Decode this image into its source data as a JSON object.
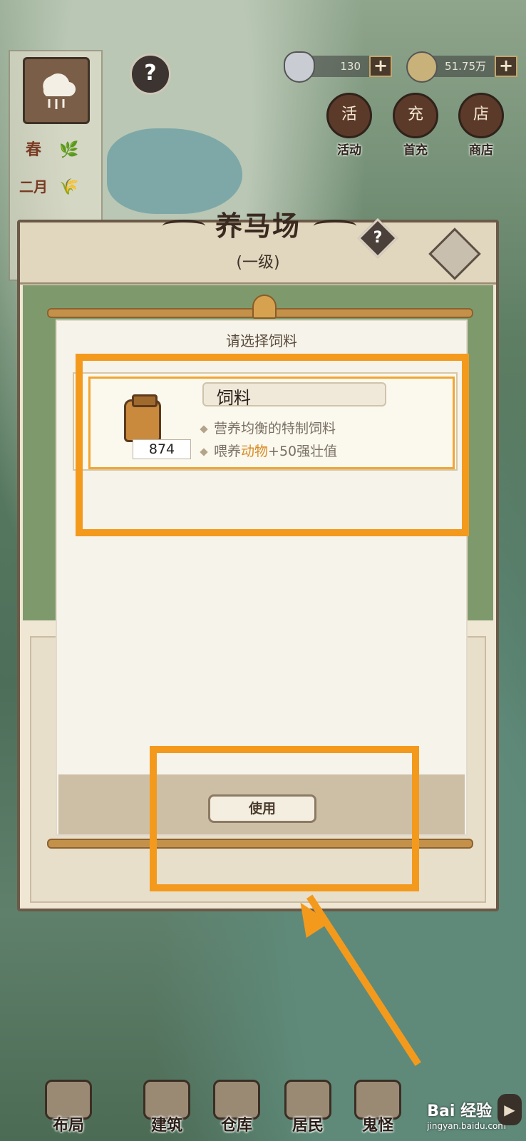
{
  "resources": {
    "ingot": {
      "value": "130",
      "plus": "+"
    },
    "coin": {
      "value": "51.75万",
      "plus": "+"
    }
  },
  "season": {
    "season_label": "春",
    "month_label": "二月",
    "help": "?"
  },
  "top_buttons": [
    {
      "label": "活动",
      "icon": "活"
    },
    {
      "label": "首充",
      "icon": "充"
    },
    {
      "label": "商店",
      "icon": "店"
    }
  ],
  "building": {
    "title": "养马场",
    "level": "(一级)",
    "help": "?"
  },
  "dialog": {
    "title": "请选择饲料",
    "item": {
      "name": "饲料",
      "count": "874",
      "desc1": "营养均衡的特制饲料",
      "desc2_prefix": "喂养",
      "desc2_highlight": "动物",
      "desc2_suffix": "+50强壮值"
    },
    "use_button": "使用"
  },
  "bottom_nav": [
    {
      "label": "布局"
    },
    {
      "label": "建筑"
    },
    {
      "label": "仓库"
    },
    {
      "label": "居民"
    },
    {
      "label": "鬼怪"
    }
  ],
  "watermark": {
    "main": "Bai 经验",
    "sub": "jingyan.baidu.com"
  },
  "colors": {
    "highlight": "#f39a1d",
    "accent_text": "#d88a22",
    "frame": "#6b5a47"
  }
}
